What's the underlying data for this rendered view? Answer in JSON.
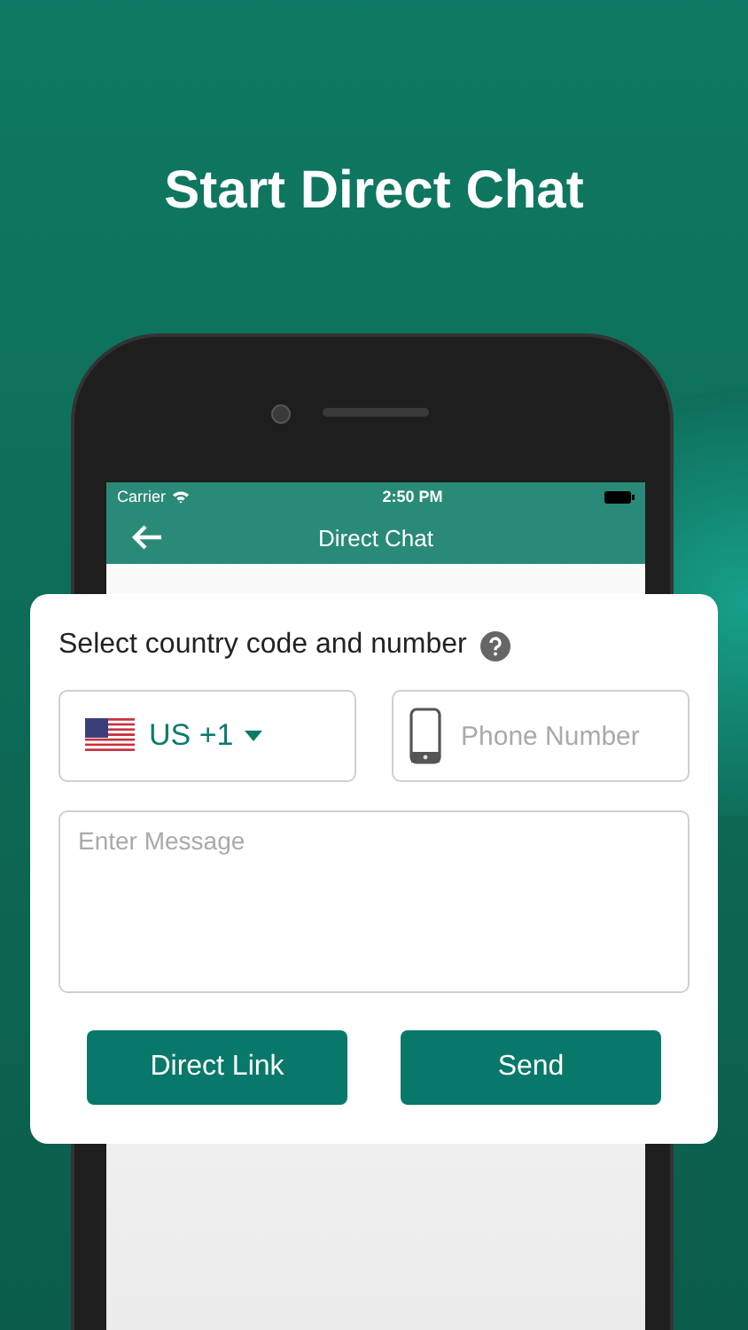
{
  "headline": "Start Direct Chat",
  "status_bar": {
    "carrier": "Carrier",
    "time": "2:50 PM"
  },
  "nav": {
    "title": "Direct Chat"
  },
  "card": {
    "title": "Select country code and number",
    "country_code": "US +1",
    "phone_field": {
      "placeholder": "Phone Number"
    },
    "message_field": {
      "placeholder": "Enter Message"
    },
    "buttons": [
      "Direct Link",
      "Send"
    ]
  }
}
